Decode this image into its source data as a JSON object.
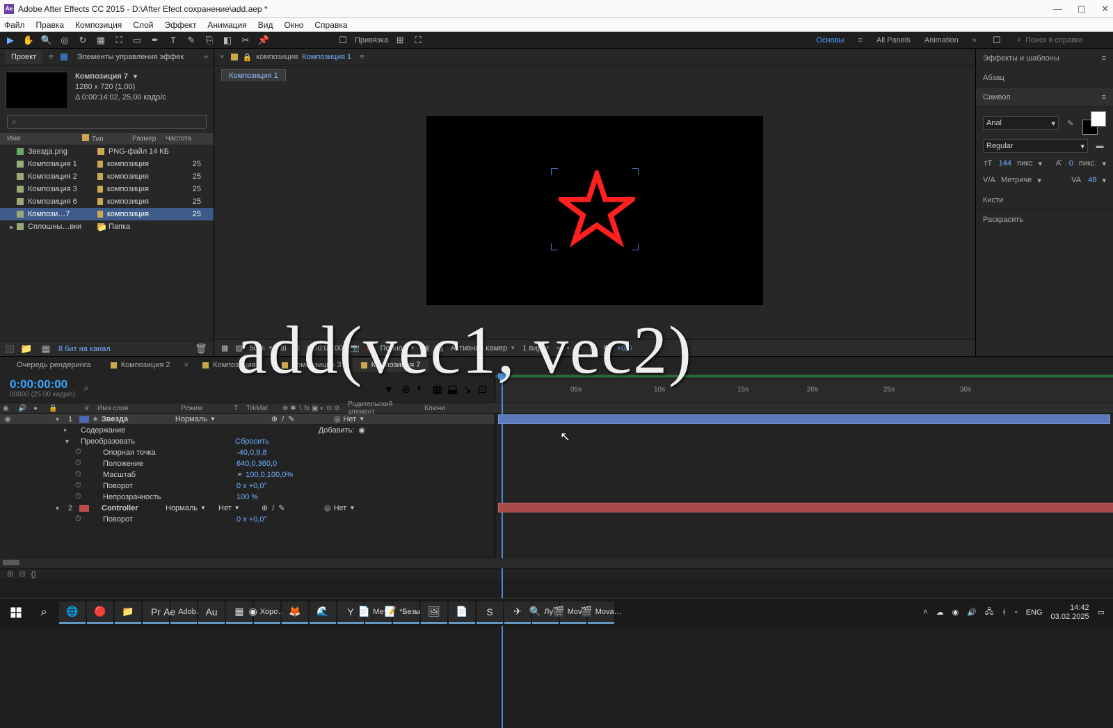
{
  "titlebar": {
    "text": "Adobe After Effects CC 2015 - D:\\After Efect сохранение\\add.aep *",
    "icon_label": "Ae"
  },
  "menu": [
    "Файл",
    "Правка",
    "Композиция",
    "Слой",
    "Эффект",
    "Анимация",
    "Вид",
    "Окно",
    "Справка"
  ],
  "toolbar": {
    "snap": "Привязка",
    "workspaces": [
      "Основы",
      "All Panels",
      "Animation"
    ],
    "search_ph": "Поиск в справке"
  },
  "project": {
    "tab_project": "Проект",
    "tab_effectctrl": "Элементы управления эффек",
    "comp_title": "Композиция 7",
    "dims": "1280 x 720 (1,00)",
    "dur": "Δ 0:00:14:02, 25,00 кадр/с",
    "search_glyph": "⌕",
    "cols": {
      "name": "Имя",
      "type": "Тип",
      "size": "Размер",
      "freq": "Частота"
    },
    "items": [
      {
        "name": "Звезда.png",
        "type": "PNG-файл",
        "size": "14 КБ",
        "rate": "",
        "icon": "png"
      },
      {
        "name": "Композиция 1",
        "type": "композиция",
        "size": "",
        "rate": "25",
        "icon": "comp"
      },
      {
        "name": "Композиция 2",
        "type": "композиция",
        "size": "",
        "rate": "25",
        "icon": "comp"
      },
      {
        "name": "Композиция 3",
        "type": "композиция",
        "size": "",
        "rate": "25",
        "icon": "comp"
      },
      {
        "name": "Композиция 6",
        "type": "композиция",
        "size": "",
        "rate": "25",
        "icon": "comp"
      },
      {
        "name": "Компози…7",
        "type": "композиция",
        "size": "",
        "rate": "25",
        "icon": "comp",
        "sel": true
      },
      {
        "name": "Сплошны…вки",
        "type": "Папка",
        "size": "",
        "rate": "",
        "icon": "folder",
        "tree": "▸"
      }
    ],
    "footer_bits": "8 бит на канал"
  },
  "viewer": {
    "crumb_label": "композиция",
    "crumb_name": "Композиция 1",
    "tab": "Композиция 1",
    "zoom": "50%",
    "timecode": "0:00:00:00",
    "quality": "Полное",
    "camera": "Активная камер",
    "views": "1 вид",
    "exposure": "+0,0"
  },
  "rightpanel": {
    "effects": "Эффекты и шаблоны",
    "para": "Абзац",
    "symbol": "Символ",
    "font": "Arial",
    "weight": "Regular",
    "size": "144",
    "size_unit": "пикс",
    "leading": "0",
    "leading_unit": "пикс.",
    "kerning": "Метриче",
    "tracking": "48",
    "brushes": "Кисти",
    "paint": "Раскрасить"
  },
  "timeline": {
    "tabs": [
      "Очередь рендеринга",
      "Композиция 2",
      "Композиция 1",
      "Композиция 3",
      "Композиция 7"
    ],
    "active_tab": 4,
    "timecode": "0:00:00:00",
    "frames": "00000 (25.00 кадр/с)",
    "ruler": [
      "05s",
      "10s",
      "15s",
      "20s",
      "25s",
      "30s"
    ],
    "cols": {
      "num": "#",
      "layer": "Имя слоя",
      "mode": "Режим",
      "t": "T",
      "trkmat": "TrkMat",
      "parent": "Родительский элемент",
      "keys": "Ключи"
    },
    "mode_normal": "Нормаль",
    "trk_none": "Нет",
    "par_none": "Нет",
    "add_label": "Добавить:",
    "layers": [
      {
        "num": "1",
        "color": "#4a6ab0",
        "name": "Звезда",
        "bold": true
      },
      {
        "num": "2",
        "color": "#c04a4a",
        "name": "Controller",
        "bold": true
      }
    ],
    "props": {
      "content": "Содержание",
      "transform": "Преобразовать",
      "reset": "Сбросить",
      "anchor": "Опорная точка",
      "anchor_v": "-40,0,9,8",
      "position": "Положение",
      "position_v": "640,0,360,0",
      "scale": "Масштаб",
      "scale_v": "100,0,100,0%",
      "rotation": "Поворот",
      "rotation_v": "0 x +0,0°",
      "opacity": "Непрозрачность",
      "opacity_v": "100 %",
      "rotation2": "Поворот",
      "rotation2_v": "0 x +0,0°"
    }
  },
  "overlay": "add(vec1, vec2)",
  "taskbar": {
    "apps": [
      {
        "label": "",
        "icon": "win"
      },
      {
        "label": "",
        "icon": "search"
      },
      {
        "label": "",
        "icon": "edge"
      },
      {
        "label": "",
        "icon": "opera"
      },
      {
        "label": "",
        "icon": "files"
      },
      {
        "label": "",
        "icon": "pr"
      },
      {
        "label": "Adob…",
        "icon": "ae"
      },
      {
        "label": "",
        "icon": "au"
      },
      {
        "label": "",
        "icon": "me"
      },
      {
        "label": "Хоро…",
        "icon": "chrome"
      },
      {
        "label": "",
        "icon": "ff"
      },
      {
        "label": "",
        "icon": "edge2"
      },
      {
        "label": "",
        "icon": "ya"
      },
      {
        "label": "Мето…",
        "icon": "doc"
      },
      {
        "label": "*Безы…",
        "icon": "np"
      },
      {
        "label": "",
        "icon": "img"
      },
      {
        "label": "",
        "icon": "doc2"
      },
      {
        "label": "",
        "icon": "sk"
      },
      {
        "label": "",
        "icon": "tg"
      },
      {
        "label": "Лупа",
        "icon": "mag"
      },
      {
        "label": "Mova…",
        "icon": "mov1"
      },
      {
        "label": "Mova…",
        "icon": "mov2"
      }
    ],
    "lang": "ENG",
    "time": "14:42",
    "date": "03.02.2025"
  }
}
